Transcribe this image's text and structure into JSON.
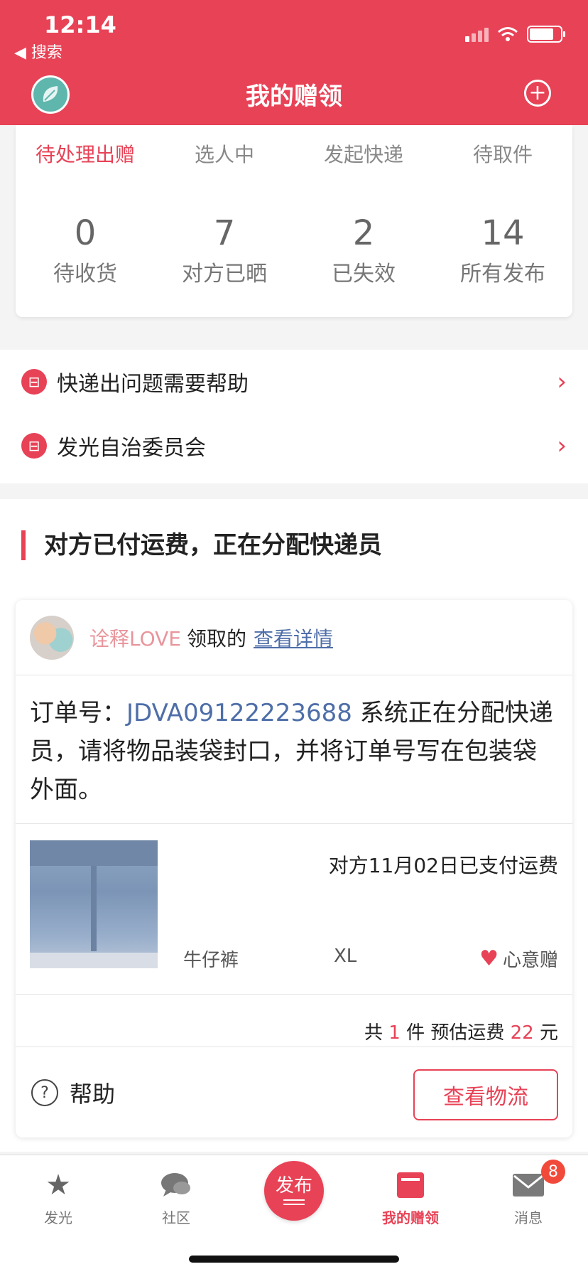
{
  "status_bar": {
    "time": "12:14",
    "back_label": "◀ 搜索"
  },
  "header": {
    "title": "我的赠领",
    "add_icon": "plus-circle-icon",
    "logo_icon": "leaf-logo"
  },
  "stats": {
    "tabs": [
      {
        "label": "待处理出赠",
        "active": true
      },
      {
        "label": "选人中",
        "active": false
      },
      {
        "label": "发起快递",
        "active": false
      },
      {
        "label": "待取件",
        "active": false
      }
    ],
    "counts": [
      {
        "value": "0",
        "label": "待收货"
      },
      {
        "value": "7",
        "label": "对方已晒"
      },
      {
        "value": "2",
        "label": "已失效"
      },
      {
        "value": "14",
        "label": "所有发布"
      }
    ]
  },
  "help_links": [
    {
      "label": "快递出问题需要帮助",
      "icon": "courier-icon"
    },
    {
      "label": "发光自治委员会",
      "icon": "courier-icon"
    }
  ],
  "section": {
    "title": "对方已付运费，正在分配快递员"
  },
  "order": {
    "receiver_name": "诠释LOVE",
    "receiver_suffix": "领取的",
    "detail_link": "查看详情",
    "message_prefix": "订单号：",
    "order_no": "JDVA09122223688",
    "message_body": " 系统正在分配快递员，请将物品装袋封口，并将订单号写在包装袋外面。",
    "paid_text": "对方11月02日已支付运费",
    "item_name": "牛仔裤",
    "item_size": "XL",
    "gift_type": "心意赠",
    "summary_prefix": "共",
    "item_count": "1",
    "summary_mid": "件 预估运费",
    "shipping_fee": "22",
    "summary_unit": "元",
    "help_label": "帮助",
    "track_button": "查看物流"
  },
  "tabbar": {
    "items": [
      {
        "label": "发光",
        "icon": "star-icon"
      },
      {
        "label": "社区",
        "icon": "chat-bubble-icon"
      },
      {
        "label": "发布",
        "icon": "publish-button"
      },
      {
        "label": "我的赠领",
        "icon": "book-icon",
        "active": true
      },
      {
        "label": "消息",
        "icon": "mail-icon",
        "badge": "8"
      }
    ]
  },
  "colors": {
    "brand": "#e84256",
    "link": "#4e6ea8"
  }
}
